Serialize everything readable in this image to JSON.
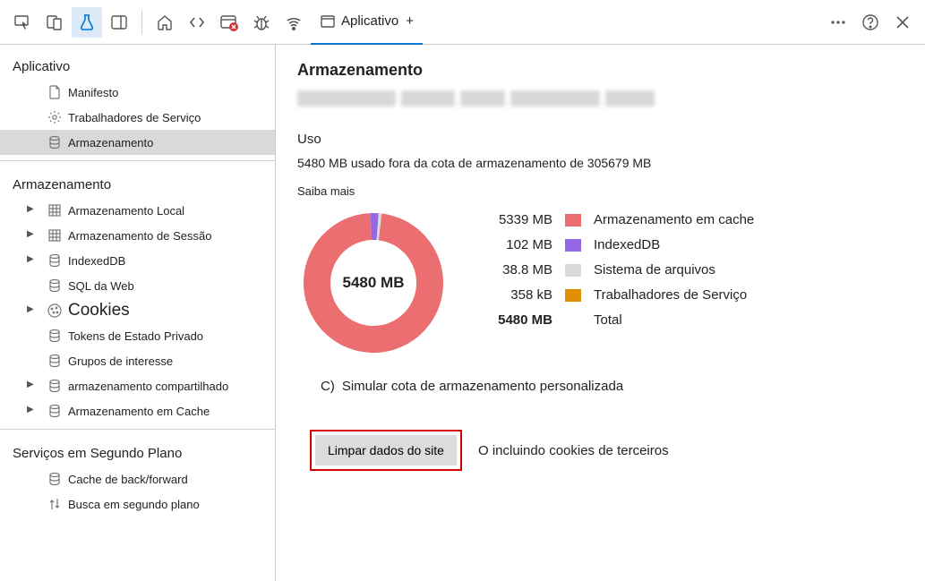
{
  "toolbar": {
    "active_tab_label": "Aplicativo",
    "plus": "+"
  },
  "sidebar": {
    "groups": [
      {
        "title": "Aplicativo",
        "items": [
          {
            "label": "Manifesto",
            "icon": "file"
          },
          {
            "label": "Trabalhadores de Serviço",
            "icon": "gear"
          },
          {
            "label": "Armazenamento",
            "icon": "db",
            "selected": true
          }
        ]
      },
      {
        "title": "Armazenamento",
        "items": [
          {
            "label": "Armazenamento Local",
            "icon": "grid",
            "exp": true
          },
          {
            "label": "Armazenamento de Sessão",
            "icon": "grid",
            "exp": true
          },
          {
            "label": "IndexedDB",
            "icon": "db",
            "exp": true
          },
          {
            "label": "SQL da Web",
            "icon": "db"
          },
          {
            "label": "Cookies",
            "icon": "cookie",
            "exp": true,
            "big": true
          },
          {
            "label": "Tokens de Estado Privado",
            "icon": "db"
          },
          {
            "label": "Grupos de interesse",
            "icon": "db"
          },
          {
            "label": "armazenamento compartilhado",
            "icon": "db",
            "exp": true
          },
          {
            "label": "Armazenamento em Cache",
            "icon": "db",
            "exp": true
          }
        ]
      },
      {
        "title": "Serviços em Segundo Plano",
        "items": [
          {
            "label": "Cache de back/forward",
            "icon": "db"
          },
          {
            "label": "Busca em segundo plano",
            "icon": "updown"
          }
        ]
      }
    ]
  },
  "content": {
    "heading": "Armazenamento",
    "usage_label": "Uso",
    "usage_value": "5480",
    "usage_rest": "MB usado fora da cota de armazenamento de 305679 MB",
    "learn_more": "Saiba mais",
    "center_label": "5480 MB",
    "simulate_prefix": "C)",
    "simulate_label": "Simular cota de armazenamento personalizada",
    "clear_button": "Limpar dados do site",
    "third_party_prefix": "O",
    "third_party": "incluindo cookies de terceiros",
    "legend": [
      {
        "value": "5339 MB",
        "color": "#eb6f71",
        "name": "Armazenamento em cache"
      },
      {
        "value": "102 MB",
        "color": "#9367e6",
        "name": "IndexedDB"
      },
      {
        "value": "38.8 MB",
        "color": "#d9d9d9",
        "name": "Sistema de arquivos"
      },
      {
        "value": "358 kB",
        "color": "#e08f00",
        "name": "Trabalhadores de Serviço"
      }
    ],
    "total_value": "5480 MB",
    "total_label": "Total"
  },
  "chart_data": {
    "type": "pie",
    "title": "Armazenamento — Uso",
    "categories": [
      "Armazenamento em cache",
      "IndexedDB",
      "Sistema de arquivos",
      "Trabalhadores de Serviço"
    ],
    "values_mb": [
      5339,
      102,
      38.8,
      0.358
    ],
    "colors": [
      "#eb6f71",
      "#9367e6",
      "#d9d9d9",
      "#e08f00"
    ],
    "total_mb": 5480,
    "quota_mb": 305679
  }
}
